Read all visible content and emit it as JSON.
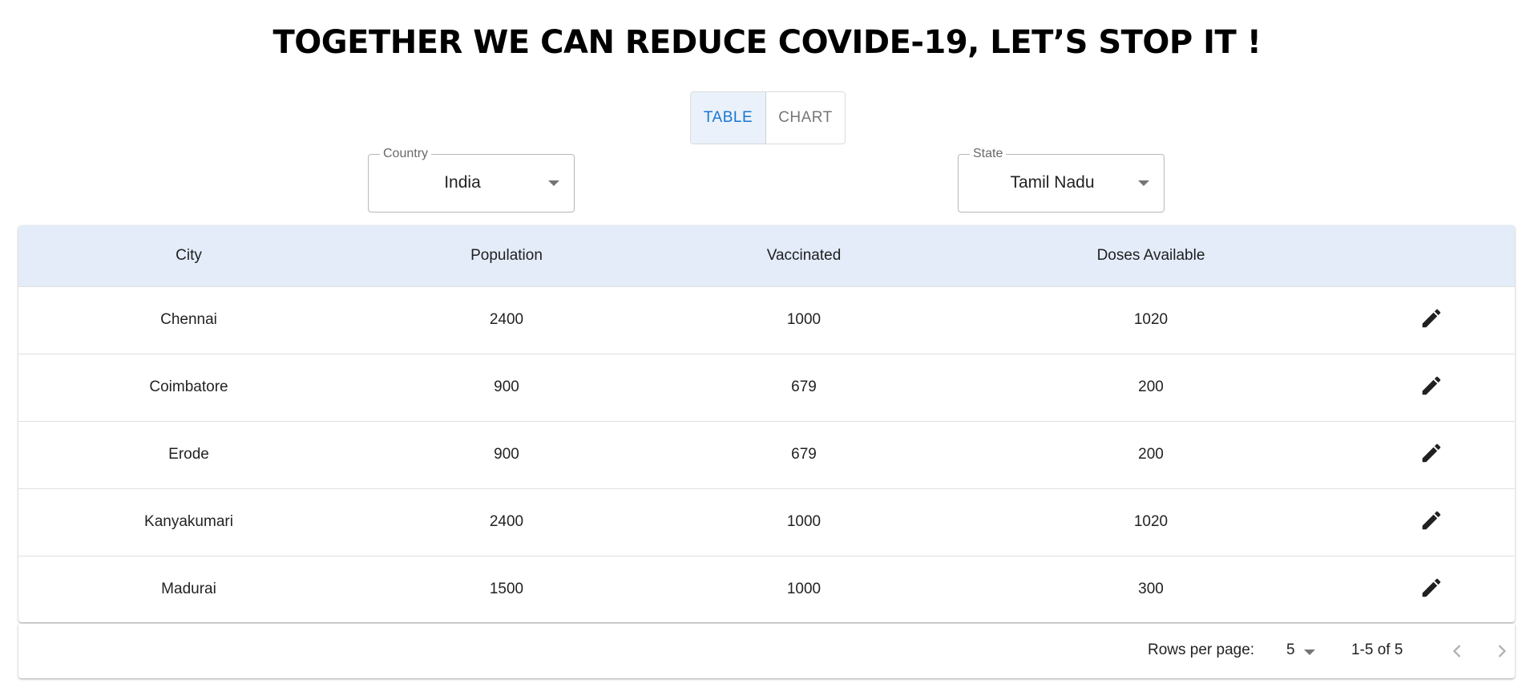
{
  "title": "TOGETHER WE CAN REDUCE COVIDE-19, LET’S STOP IT !",
  "view_toggle": {
    "table_label": "TABLE",
    "chart_label": "CHART",
    "selected": "TABLE"
  },
  "filters": {
    "country": {
      "label": "Country",
      "value": "India"
    },
    "state": {
      "label": "State",
      "value": "Tamil Nadu"
    }
  },
  "table": {
    "columns": [
      "City",
      "Population",
      "Vaccinated",
      "Doses Available"
    ],
    "rows": [
      {
        "city": "Chennai",
        "population": "2400",
        "vaccinated": "1000",
        "doses": "1020"
      },
      {
        "city": "Coimbatore",
        "population": "900",
        "vaccinated": "679",
        "doses": "200"
      },
      {
        "city": "Erode",
        "population": "900",
        "vaccinated": "679",
        "doses": "200"
      },
      {
        "city": "Kanyakumari",
        "population": "2400",
        "vaccinated": "1000",
        "doses": "1020"
      },
      {
        "city": "Madurai",
        "population": "1500",
        "vaccinated": "1000",
        "doses": "300"
      }
    ]
  },
  "pagination": {
    "rows_per_page_label": "Rows per page:",
    "rows_per_page": "5",
    "range": "1-5 of 5"
  },
  "icons": {
    "edit": "edit-icon",
    "prev": "chevron-left-icon",
    "next": "chevron-right-icon"
  },
  "colors": {
    "accent": "#1976d2",
    "header_bg": "#e3ecf8",
    "toggle_selected_bg": "#eaf1fa"
  }
}
